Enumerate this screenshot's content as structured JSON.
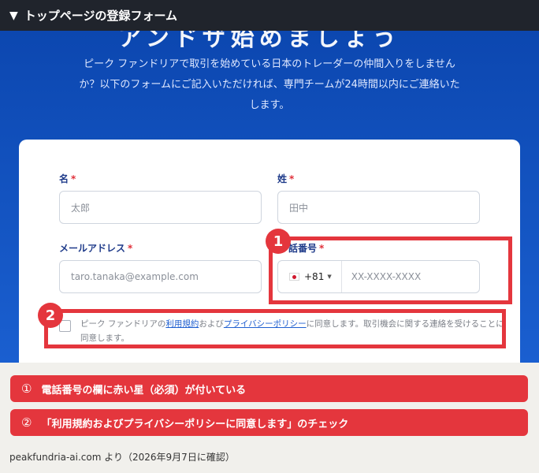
{
  "header": {
    "toggle_icon": "triangle-down-icon",
    "title": "トップページの登録フォーム"
  },
  "hero": {
    "cut_title": "アンドザ始めましょう",
    "lead": "ピーク ファンドリアで取引を始めている日本のトレーダーの仲間入りをしませんか？以下のフォームにご記入いただければ、専門チームが24時間以内にご連絡いたします。"
  },
  "form": {
    "first_name": {
      "label": "名",
      "required_mark": "*",
      "placeholder": "太郎"
    },
    "last_name": {
      "label": "姓",
      "required_mark": "*",
      "placeholder": "田中"
    },
    "email": {
      "label": "メールアドレス",
      "required_mark": "*",
      "placeholder": "taro.tanaka@example.com"
    },
    "phone": {
      "label": "話番号",
      "required_mark": "*",
      "country_code": "+81",
      "placeholder": "XX-XXXX-XXXX",
      "flag": "japan-flag-icon"
    },
    "consent": {
      "pre": "ピーク ファンドリアの",
      "terms_link": "利用規約",
      "mid": "および",
      "privacy_link": "プライバシーポリシー",
      "post": "に同意します。取引機会に関する連絡を受けることに同意します。"
    }
  },
  "annotations": {
    "badge_1": "1",
    "badge_2": "2",
    "accent_color": "#e4363d"
  },
  "notes": [
    {
      "num": "①",
      "text": "電話番号の欄に赤い星（必須）が付いている"
    },
    {
      "num": "②",
      "text": "「利用規約およびプライバシーポリシーに同意します」のチェック"
    }
  ],
  "footer": "peakfundria-ai.com より（2026年9月7日に確認）"
}
